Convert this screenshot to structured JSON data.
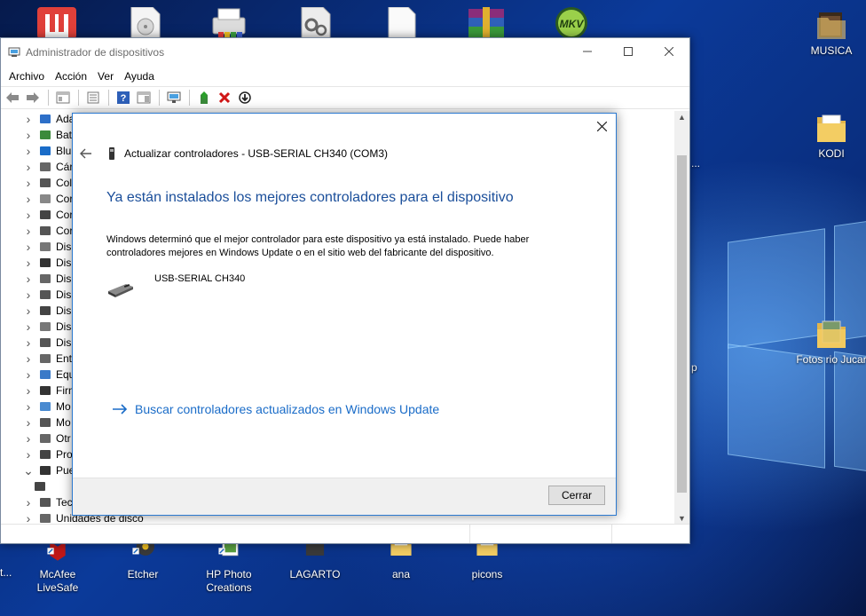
{
  "desktop": {
    "right_icons": [
      {
        "label": "MUSICA"
      },
      {
        "label": "KODI"
      },
      {
        "label": "Fotos rio Jucar"
      }
    ],
    "bottom_icons": [
      {
        "label": "McAfee LiveSafe"
      },
      {
        "label": "Etcher"
      },
      {
        "label": "HP Photo Creations"
      },
      {
        "label": "LAGARTO"
      },
      {
        "label": "ana"
      },
      {
        "label": "picons"
      }
    ],
    "top_icons": [
      {
        "label": ""
      },
      {
        "label": ""
      },
      {
        "label": ""
      },
      {
        "label": ""
      },
      {
        "label": ""
      },
      {
        "label": ""
      },
      {
        "label": "MKV"
      }
    ],
    "edge_fragments": [
      "...",
      "p",
      "t..."
    ]
  },
  "device_manager": {
    "title": "Administrador de dispositivos",
    "menu": [
      "Archivo",
      "Acción",
      "Ver",
      "Ayuda"
    ],
    "tree": [
      {
        "label": "Ada",
        "expanded": false
      },
      {
        "label": "Bat",
        "expanded": false
      },
      {
        "label": "Blu",
        "expanded": false
      },
      {
        "label": "Cár",
        "expanded": false
      },
      {
        "label": "Col",
        "expanded": false
      },
      {
        "label": "Cor",
        "expanded": false
      },
      {
        "label": "Cor",
        "expanded": false
      },
      {
        "label": "Cor",
        "expanded": false
      },
      {
        "label": "Disp",
        "expanded": false
      },
      {
        "label": "Disp",
        "expanded": false
      },
      {
        "label": "Disp",
        "expanded": false
      },
      {
        "label": "Disp",
        "expanded": false
      },
      {
        "label": "Disp",
        "expanded": false
      },
      {
        "label": "Disp",
        "expanded": false
      },
      {
        "label": "Disp",
        "expanded": false
      },
      {
        "label": "Ent",
        "expanded": false
      },
      {
        "label": "Equ",
        "expanded": false
      },
      {
        "label": "Firn",
        "expanded": false
      },
      {
        "label": "Mo",
        "expanded": false
      },
      {
        "label": "Mo",
        "expanded": false
      },
      {
        "label": "Otr",
        "expanded": false
      },
      {
        "label": "Pro",
        "expanded": false
      },
      {
        "label": "Pue",
        "expanded": true
      },
      {
        "label": "",
        "expanded": false,
        "child": true
      },
      {
        "label": "Tec",
        "expanded": false
      },
      {
        "label": "Unidades de disco",
        "expanded": false
      }
    ]
  },
  "dialog": {
    "header": "Actualizar controladores - USB-SERIAL CH340 (COM3)",
    "heading": "Ya están instalados los mejores controladores para el dispositivo",
    "body": "Windows determinó que el mejor controlador para este dispositivo ya está instalado. Puede haber controladores mejores en Windows Update o en el sitio web del fabricante del dispositivo.",
    "device_name": "USB-SERIAL CH340",
    "link": "Buscar controladores actualizados en Windows Update",
    "close_button": "Cerrar"
  },
  "colors": {
    "heading_blue": "#1a4e9a",
    "link_blue": "#1a6cc8",
    "dialog_border": "#2b79d0",
    "danger_red": "#d01616"
  }
}
